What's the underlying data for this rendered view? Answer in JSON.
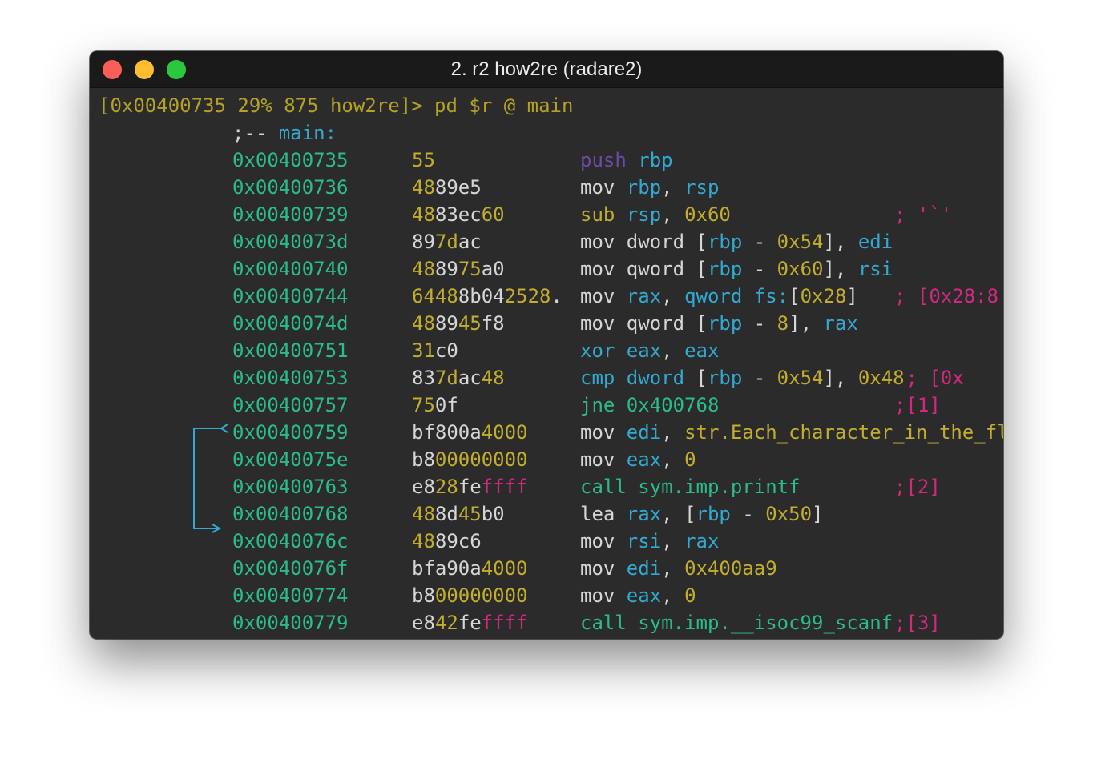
{
  "window": {
    "title": "2. r2 how2re (radare2)"
  },
  "prompt": {
    "text": "[0x00400735 29% 875 how2re]> ",
    "command": "pd $r @ main"
  },
  "function_flag": {
    "prefix": ";-- ",
    "name": "main:"
  },
  "colors": {
    "background": "#2b2b2b",
    "address": "#2bbc8a",
    "yellow": "#c2ad2e",
    "cyan": "#33a9d1",
    "magenta": "#d3287f",
    "purple": "#6f4aa7"
  },
  "rows": [
    {
      "addr": "0x00400735",
      "bytes": [
        [
          "55",
          "y"
        ]
      ],
      "instr": [
        [
          "push",
          "p"
        ],
        [
          " ",
          "w"
        ],
        [
          "rbp",
          "c"
        ]
      ],
      "comment": ""
    },
    {
      "addr": "0x00400736",
      "bytes": [
        [
          "48",
          "y"
        ],
        [
          "89e5",
          "w"
        ]
      ],
      "instr": [
        [
          "mov ",
          "w"
        ],
        [
          "rbp",
          "c"
        ],
        [
          ", ",
          "w"
        ],
        [
          "rsp",
          "c"
        ]
      ],
      "comment": ""
    },
    {
      "addr": "0x00400739",
      "bytes": [
        [
          "48",
          "y"
        ],
        [
          "83ec",
          "w"
        ],
        [
          "60",
          "y"
        ]
      ],
      "instr": [
        [
          "sub ",
          "y"
        ],
        [
          "rsp",
          "c"
        ],
        [
          ", ",
          "w"
        ],
        [
          "0x60",
          "y"
        ]
      ],
      "comment": "; '`'"
    },
    {
      "addr": "0x0040073d",
      "bytes": [
        [
          "89",
          "w"
        ],
        [
          "7d",
          "y"
        ],
        [
          "ac",
          "w"
        ]
      ],
      "instr": [
        [
          "mov ",
          "w"
        ],
        [
          "dword ",
          "w"
        ],
        [
          "[",
          "w"
        ],
        [
          "rbp",
          "c"
        ],
        [
          " - ",
          "w"
        ],
        [
          "0x54",
          "y"
        ],
        [
          "], ",
          "w"
        ],
        [
          "edi",
          "c"
        ]
      ],
      "comment": ""
    },
    {
      "addr": "0x00400740",
      "bytes": [
        [
          "48",
          "y"
        ],
        [
          "89",
          "w"
        ],
        [
          "75",
          "y"
        ],
        [
          "a0",
          "w"
        ]
      ],
      "instr": [
        [
          "mov ",
          "w"
        ],
        [
          "qword ",
          "w"
        ],
        [
          "[",
          "w"
        ],
        [
          "rbp",
          "c"
        ],
        [
          " - ",
          "w"
        ],
        [
          "0x60",
          "y"
        ],
        [
          "], ",
          "w"
        ],
        [
          "rsi",
          "c"
        ]
      ],
      "comment": ""
    },
    {
      "addr": "0x00400744",
      "bytes": [
        [
          "6448",
          "y"
        ],
        [
          "8b04",
          "w"
        ],
        [
          "2528",
          "y"
        ],
        [
          ".",
          "w"
        ]
      ],
      "instr": [
        [
          "mov ",
          "w"
        ],
        [
          "rax",
          "c"
        ],
        [
          ", ",
          "w"
        ],
        [
          "qword ",
          "c"
        ],
        [
          "fs:",
          "c"
        ],
        [
          "[",
          "w"
        ],
        [
          "0x28",
          "y"
        ],
        [
          "]",
          "w"
        ]
      ],
      "comment": "; [0x28:8"
    },
    {
      "addr": "0x0040074d",
      "bytes": [
        [
          "48",
          "y"
        ],
        [
          "89",
          "w"
        ],
        [
          "45",
          "y"
        ],
        [
          "f8",
          "w"
        ]
      ],
      "instr": [
        [
          "mov ",
          "w"
        ],
        [
          "qword ",
          "w"
        ],
        [
          "[",
          "w"
        ],
        [
          "rbp",
          "c"
        ],
        [
          " - ",
          "w"
        ],
        [
          "8",
          "y"
        ],
        [
          "], ",
          "w"
        ],
        [
          "rax",
          "c"
        ]
      ],
      "comment": ""
    },
    {
      "addr": "0x00400751",
      "bytes": [
        [
          "31",
          "y"
        ],
        [
          "c0",
          "w"
        ]
      ],
      "instr": [
        [
          "xor ",
          "c"
        ],
        [
          "eax",
          "c"
        ],
        [
          ", ",
          "w"
        ],
        [
          "eax",
          "c"
        ]
      ],
      "comment": ""
    },
    {
      "addr": "0x00400753",
      "bytes": [
        [
          "83",
          "w"
        ],
        [
          "7d",
          "y"
        ],
        [
          "ac",
          "w"
        ],
        [
          "48",
          "y"
        ]
      ],
      "instr": [
        [
          "cmp ",
          "c"
        ],
        [
          "dword ",
          "c"
        ],
        [
          "[",
          "w"
        ],
        [
          "rbp",
          "c"
        ],
        [
          " - ",
          "w"
        ],
        [
          "0x54",
          "y"
        ],
        [
          "], ",
          "w"
        ],
        [
          "0x48",
          "y"
        ]
      ],
      "comment": " ; [0x"
    },
    {
      "addr": "0x00400757",
      "bytes": [
        [
          "75",
          "y"
        ],
        [
          "0f",
          "w"
        ]
      ],
      "instr": [
        [
          "jne ",
          "g"
        ],
        [
          "0x400768",
          "g"
        ]
      ],
      "comment": ";[1]"
    },
    {
      "addr": "0x00400759",
      "bytes": [
        [
          "bf800a",
          "w"
        ],
        [
          "4000",
          "y"
        ]
      ],
      "instr": [
        [
          "mov ",
          "w"
        ],
        [
          "edi",
          "c"
        ],
        [
          ", ",
          "w"
        ],
        [
          "str.Each_character_in_the_fl",
          "y"
        ]
      ],
      "comment": ""
    },
    {
      "addr": "0x0040075e",
      "bytes": [
        [
          "b8",
          "w"
        ],
        [
          "00000000",
          "y"
        ]
      ],
      "instr": [
        [
          "mov ",
          "w"
        ],
        [
          "eax",
          "c"
        ],
        [
          ", ",
          "w"
        ],
        [
          "0",
          "y"
        ]
      ],
      "comment": ""
    },
    {
      "addr": "0x00400763",
      "bytes": [
        [
          "e8",
          "w"
        ],
        [
          "28",
          "y"
        ],
        [
          "fe",
          "w"
        ],
        [
          "ffff",
          "m"
        ]
      ],
      "instr": [
        [
          "call ",
          "g"
        ],
        [
          "sym.imp.printf",
          "g"
        ]
      ],
      "comment": ";[2]"
    },
    {
      "addr": "0x00400768",
      "bytes": [
        [
          "48",
          "y"
        ],
        [
          "8d",
          "w"
        ],
        [
          "45",
          "y"
        ],
        [
          "b0",
          "w"
        ]
      ],
      "instr": [
        [
          "lea ",
          "w"
        ],
        [
          "rax",
          "c"
        ],
        [
          ", ",
          "w"
        ],
        [
          "[",
          "w"
        ],
        [
          "rbp",
          "c"
        ],
        [
          " - ",
          "w"
        ],
        [
          "0x50",
          "y"
        ],
        [
          "]",
          "w"
        ]
      ],
      "comment": ""
    },
    {
      "addr": "0x0040076c",
      "bytes": [
        [
          "48",
          "y"
        ],
        [
          "89c6",
          "w"
        ]
      ],
      "instr": [
        [
          "mov ",
          "w"
        ],
        [
          "rsi",
          "c"
        ],
        [
          ", ",
          "w"
        ],
        [
          "rax",
          "c"
        ]
      ],
      "comment": ""
    },
    {
      "addr": "0x0040076f",
      "bytes": [
        [
          "bfa90a",
          "w"
        ],
        [
          "4000",
          "y"
        ]
      ],
      "instr": [
        [
          "mov ",
          "w"
        ],
        [
          "edi",
          "c"
        ],
        [
          ", ",
          "w"
        ],
        [
          "0x400aa9",
          "y"
        ]
      ],
      "comment": ""
    },
    {
      "addr": "0x00400774",
      "bytes": [
        [
          "b8",
          "w"
        ],
        [
          "00000000",
          "y"
        ]
      ],
      "instr": [
        [
          "mov ",
          "w"
        ],
        [
          "eax",
          "c"
        ],
        [
          ", ",
          "w"
        ],
        [
          "0",
          "y"
        ]
      ],
      "comment": ""
    },
    {
      "addr": "0x00400779",
      "bytes": [
        [
          "e8",
          "w"
        ],
        [
          "42",
          "y"
        ],
        [
          "fe",
          "w"
        ],
        [
          "ffff",
          "m"
        ]
      ],
      "instr": [
        [
          "call ",
          "g"
        ],
        [
          "sym.imp.__isoc99_scanf",
          "g"
        ]
      ],
      "comment": ";[3]"
    }
  ]
}
